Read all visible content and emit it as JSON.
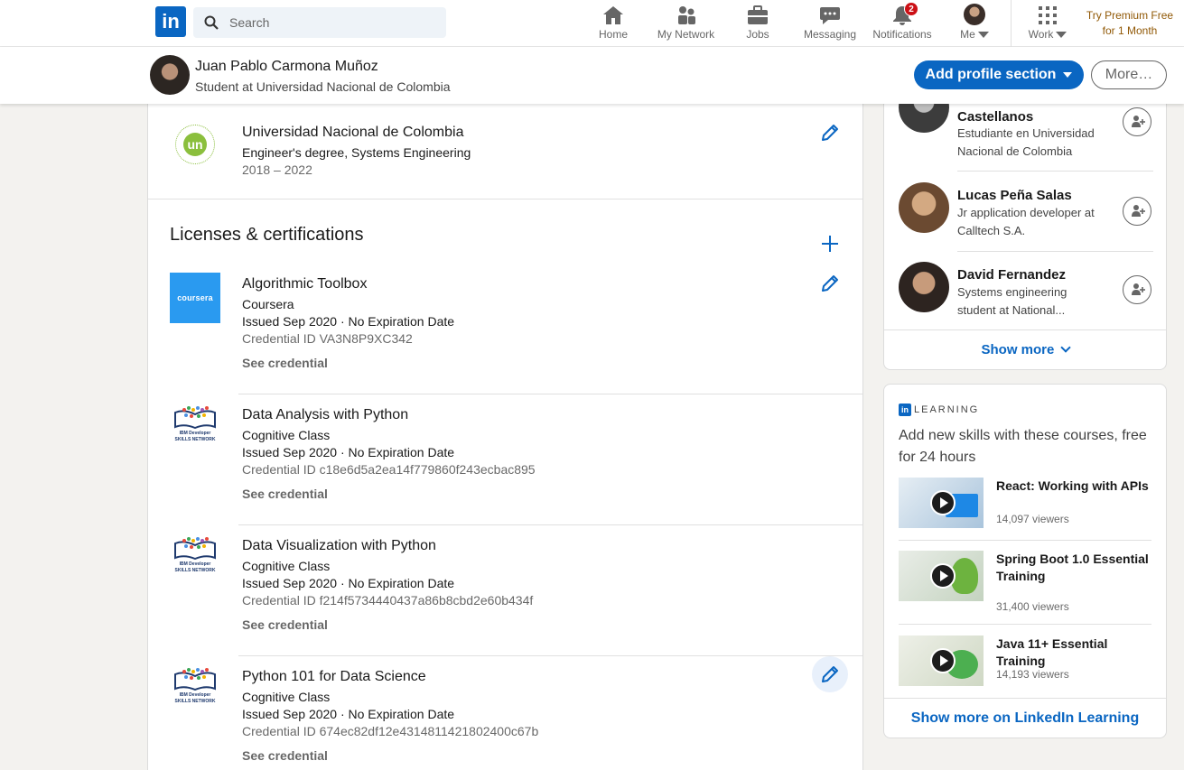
{
  "nav": {
    "logo": "in",
    "search_placeholder": "Search",
    "items": [
      {
        "label": "Home",
        "icon": "home-icon"
      },
      {
        "label": "My Network",
        "icon": "network-icon"
      },
      {
        "label": "Jobs",
        "icon": "briefcase-icon"
      },
      {
        "label": "Messaging",
        "icon": "message-icon"
      },
      {
        "label": "Notifications",
        "icon": "bell-icon",
        "badge": "2"
      },
      {
        "label": "Me",
        "icon": "avatar"
      },
      {
        "label": "Work",
        "icon": "grid-icon"
      }
    ],
    "premium": "Try Premium Free for 1 Month"
  },
  "profile_bar": {
    "name": "Juan Pablo Carmona Muñoz",
    "headline": "Student at Universidad Nacional de Colombia",
    "add_section": "Add profile section",
    "more": "More…"
  },
  "education": {
    "school": "Universidad Nacional de Colombia",
    "degree": "Engineer's degree, Systems Engineering",
    "years": "2018 – 2022",
    "logo_text": "un"
  },
  "licenses": {
    "title": "Licenses & certifications",
    "items": [
      {
        "name": "Algorithmic Toolbox",
        "issuer": "Coursera",
        "issued": "Issued Sep 2020 · No Expiration Date",
        "credential": "Credential ID VA3N8P9XC342",
        "link": "See credential",
        "logo": "coursera"
      },
      {
        "name": "Data Analysis with Python",
        "issuer": "Cognitive Class",
        "issued": "Issued Sep 2020 · No Expiration Date",
        "credential": "Credential ID c18e6d5a2ea14f779860f243ecbac895",
        "link": "See credential",
        "logo": "ibm"
      },
      {
        "name": "Data Visualization with Python",
        "issuer": "Cognitive Class",
        "issued": "Issued Sep 2020 · No Expiration Date",
        "credential": "Credential ID f214f5734440437a86b8cbd2e60b434f",
        "link": "See credential",
        "logo": "ibm"
      },
      {
        "name": "Python 101 for Data Science",
        "issuer": "Cognitive Class",
        "issued": "Issued Sep 2020 · No Expiration Date",
        "credential": "Credential ID 674ec82df12e4314811421802400c67b",
        "link": "See credential",
        "logo": "ibm"
      }
    ],
    "coursera_logo_text": "coursera",
    "ibm_logo_text": "IBM Developer SKILLS NETWORK"
  },
  "people": {
    "items": [
      {
        "name": "Castellanos",
        "headline": "Estudiante en Universidad Nacional de Colombia"
      },
      {
        "name": "Lucas Peña Salas",
        "headline": "Jr application developer at Calltech S.A."
      },
      {
        "name": "David Fernandez",
        "headline": "Systems engineering student at National..."
      }
    ],
    "show_more": "Show more"
  },
  "learning": {
    "brand": "LEARNING",
    "intro": "Add new skills with these courses, free for 24 hours",
    "courses": [
      {
        "title": "React: Working with APIs",
        "viewers": "14,097 viewers"
      },
      {
        "title": "Spring Boot 1.0 Essential Training",
        "viewers": "31,400 viewers"
      },
      {
        "title": "Java 11+ Essential Training",
        "viewers": "14,193 viewers"
      }
    ],
    "show_more": "Show more on LinkedIn Learning"
  },
  "colors": {
    "brand": "#0a66c2",
    "premium": "#915907",
    "badge": "#cc1016"
  }
}
